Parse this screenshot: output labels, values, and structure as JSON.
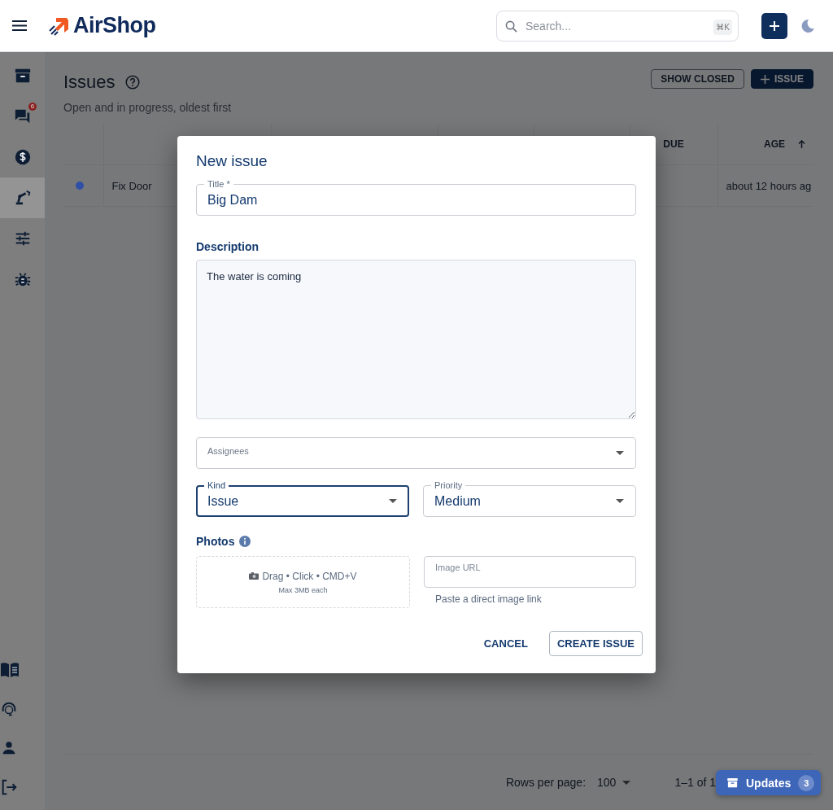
{
  "header": {
    "logo": "AirShop",
    "search": {
      "placeholder": "Search...",
      "shortcut": "⌘K"
    }
  },
  "sidebar": {
    "items": [
      {
        "kind": "archive",
        "selected": false
      },
      {
        "kind": "chat",
        "selected": false,
        "badge": "6"
      },
      {
        "kind": "dollar",
        "selected": false
      },
      {
        "kind": "robot",
        "selected": true
      },
      {
        "kind": "sliders",
        "selected": false
      },
      {
        "kind": "bug",
        "selected": false
      }
    ],
    "bottom_items": [
      {
        "kind": "book"
      },
      {
        "kind": "support"
      },
      {
        "kind": "person"
      },
      {
        "kind": "logout"
      }
    ]
  },
  "page": {
    "title": "Issues",
    "subtitle": "Open and in progress, oldest first",
    "buttons": [
      {
        "label": "SHOW CLOSED",
        "kind": "outlined"
      },
      {
        "label": "ISSUE",
        "kind": "add"
      }
    ]
  },
  "table": {
    "columns": [
      {
        "label": "DUE",
        "sorted": false
      },
      {
        "label": "AGE",
        "sorted": true
      }
    ],
    "rows": [
      {
        "color": "#3050a8",
        "title": "Fix Door",
        "age": "about 12 hours ag"
      }
    ]
  },
  "pagination": {
    "rows_per_page_label": "Rows per page:",
    "rows_per_page": "100",
    "range": "1–1 of 1"
  },
  "updates": {
    "label": "Updates",
    "count": "3"
  },
  "dialog": {
    "title": "New issue",
    "title_field": {
      "label": "Title *",
      "value": "Big Dam"
    },
    "description": {
      "label": "Description",
      "value": "The water is coming"
    },
    "assignees": {
      "label": "Assignees"
    },
    "kind": {
      "label": "Kind",
      "value": "Issue",
      "focused": true
    },
    "priority": {
      "label": "Priority",
      "value": "Medium",
      "focused": false
    },
    "photos": {
      "label": "Photos",
      "drop_text": "Drag • Click • CMD+V",
      "drop_hint": "Max 3MB each",
      "url_placeholder": "Image URL",
      "url_helper": "Paste a direct image link"
    },
    "buttons": [
      {
        "label": "CANCEL",
        "kind": "text"
      },
      {
        "label": "CREATE ISSUE",
        "kind": "outlined"
      }
    ]
  }
}
